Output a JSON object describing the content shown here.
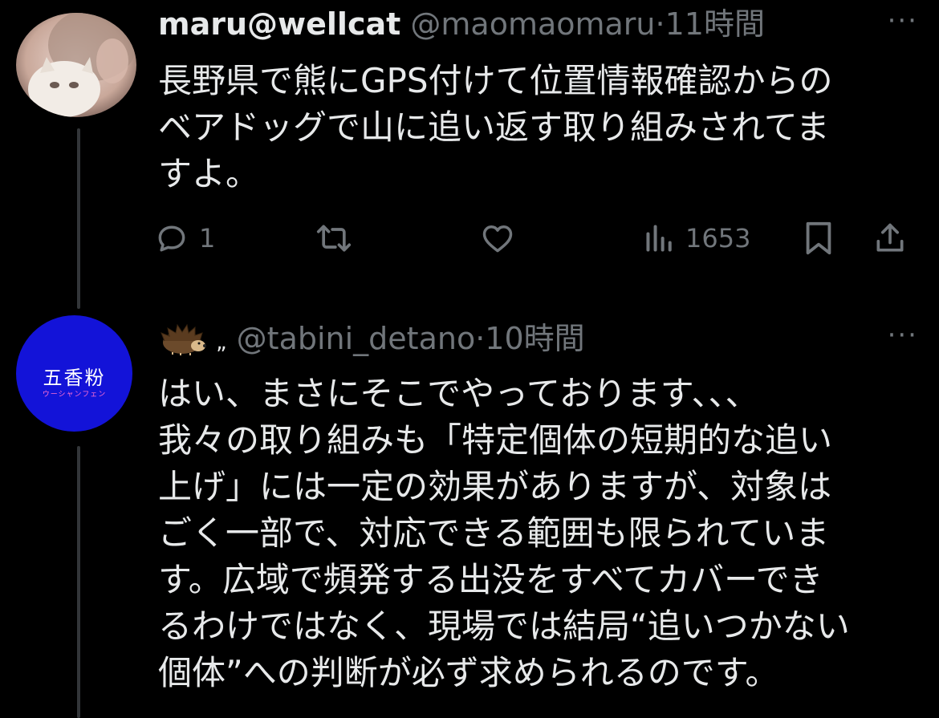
{
  "tweets": [
    {
      "name": "maru@wellcat",
      "handle": "@maomaomaru",
      "separator": "·",
      "time": "11時間",
      "text": "長野県で熊にGPS付けて位置情報確認からの\nベアドッグで山に追い返す取り組みされてま\nすよ。",
      "replies": "1",
      "views": "1653"
    },
    {
      "name_suffix": "„",
      "handle": "@tabini_detano",
      "separator": "·",
      "time": "10時間",
      "text": "はい、まさにそこでやっております、、、\n我々の取り組みも「特定個体の短期的な追い\n上げ」には一定の効果がありますが、対象は\nごく一部で、対応できる範囲も限られていま\nす。広域で頻発する出没をすべてカバーでき\nるわけではなく、現場では結局“追いつかない\n個体”への判断が必ず求められるのです。",
      "avatar_text": "五香粉",
      "avatar_subtext": "ウーシャンフェン"
    }
  ],
  "more_label": "···",
  "colors": {
    "background": "#000000",
    "text": "#e7e9ea",
    "muted": "#71767b",
    "avatar2_bg": "#1313d8"
  }
}
